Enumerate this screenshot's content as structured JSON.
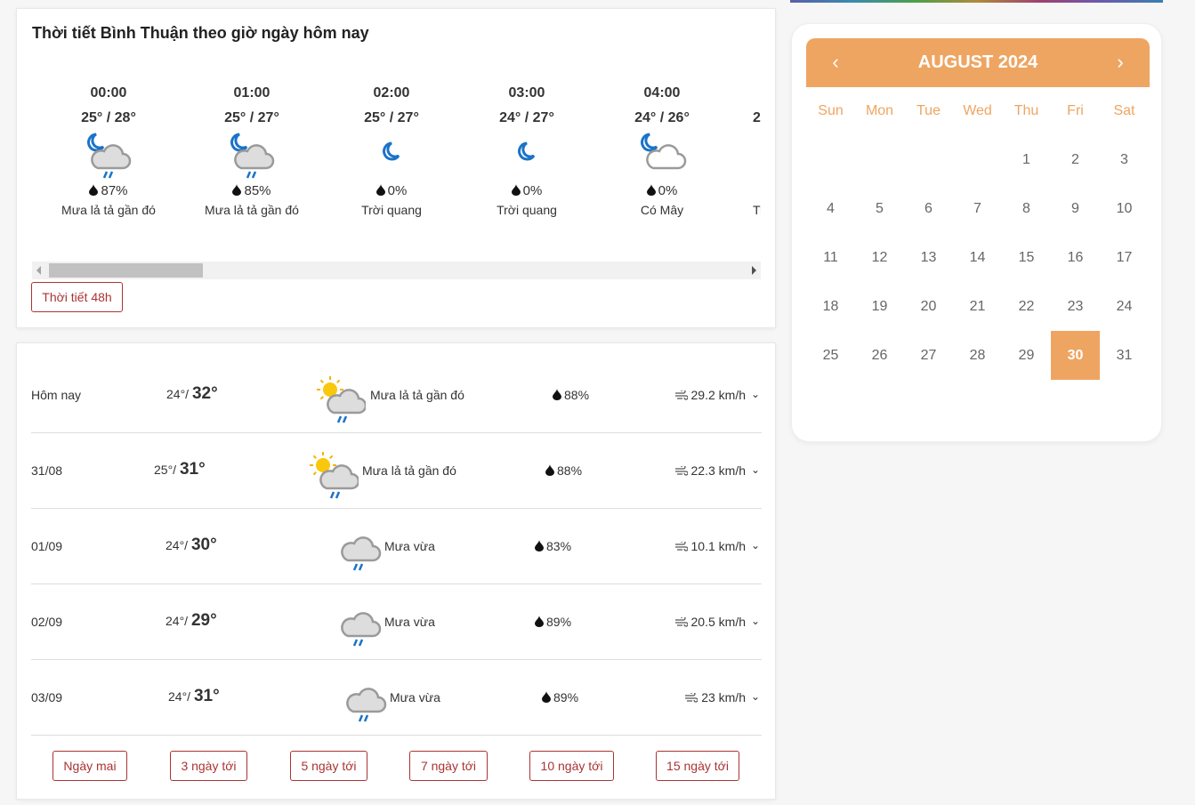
{
  "hourly": {
    "title": "Thời tiết Bình Thuận theo giờ ngày hôm nay",
    "items": [
      {
        "time": "00:00",
        "temp": "25° / 28°",
        "icon": "moon-cloud-rain",
        "humidity": "87%",
        "desc": "Mưa lả tả gần đó"
      },
      {
        "time": "01:00",
        "temp": "25° / 27°",
        "icon": "moon-cloud-rain",
        "humidity": "85%",
        "desc": "Mưa lả tả gần đó"
      },
      {
        "time": "02:00",
        "temp": "25° / 27°",
        "icon": "moon",
        "humidity": "0%",
        "desc": "Trời quang"
      },
      {
        "time": "03:00",
        "temp": "24° / 27°",
        "icon": "moon",
        "humidity": "0%",
        "desc": "Trời quang"
      },
      {
        "time": "04:00",
        "temp": "24° / 26°",
        "icon": "moon-cloud",
        "humidity": "0%",
        "desc": "Có Mây"
      }
    ],
    "partial": {
      "temp": "2",
      "desc": "Tr"
    },
    "button": "Thời tiết 48h"
  },
  "daily": {
    "rows": [
      {
        "date": "Hôm nay",
        "low": "24°",
        "high": "32°",
        "icon": "sun-cloud-rain",
        "desc": "Mưa lả tả gần đó",
        "humidity": "88%",
        "wind": "29.2 km/h"
      },
      {
        "date": "31/08",
        "low": "25°",
        "high": "31°",
        "icon": "sun-cloud-rain",
        "desc": "Mưa lả tả gần đó",
        "humidity": "88%",
        "wind": "22.3 km/h"
      },
      {
        "date": "01/09",
        "low": "24°",
        "high": "30°",
        "icon": "cloud-rain",
        "desc": "Mưa vừa",
        "humidity": "83%",
        "wind": "10.1 km/h"
      },
      {
        "date": "02/09",
        "low": "24°",
        "high": "29°",
        "icon": "cloud-rain",
        "desc": "Mưa vừa",
        "humidity": "89%",
        "wind": "20.5 km/h"
      },
      {
        "date": "03/09",
        "low": "24°",
        "high": "31°",
        "icon": "cloud-rain",
        "desc": "Mưa vừa",
        "humidity": "89%",
        "wind": "23 km/h"
      }
    ],
    "buttons": [
      "Ngày mai",
      "3 ngày tới",
      "5 ngày tới",
      "7 ngày tới",
      "10 ngày tới",
      "15 ngày tới"
    ]
  },
  "calendar": {
    "title": "AUGUST 2024",
    "prev": "‹",
    "next": "›",
    "day_names": [
      "Sun",
      "Mon",
      "Tue",
      "Wed",
      "Thu",
      "Fri",
      "Sat"
    ],
    "first_weekday": 4,
    "days_in_month": 31,
    "selected": 30,
    "accent": "#eea562"
  },
  "colors": {
    "button_border": "#aa3333",
    "icon_blue": "#1a73c8"
  }
}
